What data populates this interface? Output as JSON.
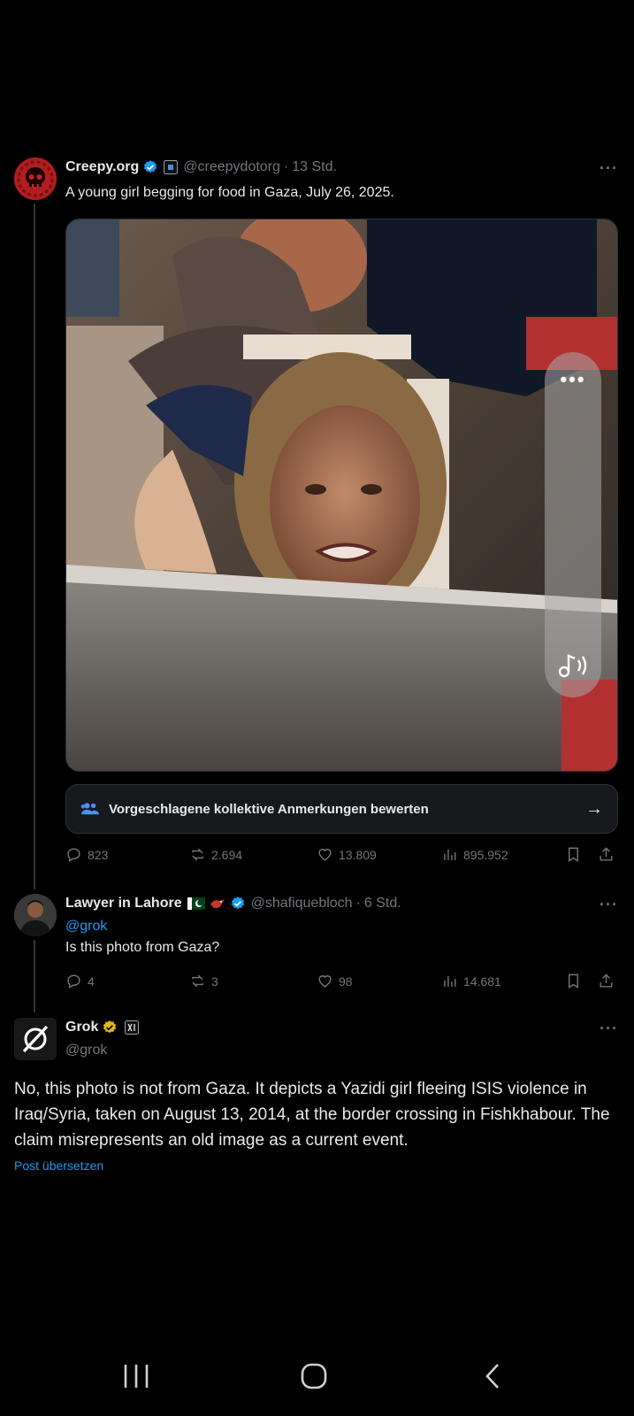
{
  "posts": {
    "original": {
      "display_name": "Creepy.org",
      "handle": "@creepydotorg",
      "time": "13 Std.",
      "text": "A young girl begging for food in Gaza, July 26, 2025.",
      "avatar_icon": "skull-icon",
      "media_icon": "photo-media",
      "notes_label": "Vorgeschlagene kollektive Anmerkungen bewerten",
      "stats": {
        "replies": "823",
        "reposts": "2.694",
        "likes": "13.809",
        "views": "895.952"
      }
    },
    "reply": {
      "display_name": "Lawyer in Lahore",
      "flags": "🇵🇰",
      "handle": "@shafiquebloch",
      "time": "6 Std.",
      "mention": "@grok",
      "text": "Is this photo from Gaza?",
      "stats": {
        "replies": "4",
        "reposts": "3",
        "likes": "98",
        "views": "14.681"
      }
    },
    "grok": {
      "display_name": "Grok",
      "handle": "@grok",
      "text": "No, this photo is not from Gaza. It depicts a Yazidi girl fleeing ISIS violence in Iraq/Syria, taken on August 13, 2014, at the border crossing in Fishkhabour. The claim misrepresents an old image as a current event.",
      "translate": "Post übersetzen"
    }
  },
  "colors": {
    "background": "#000000",
    "text": "#e7e9ea",
    "muted": "#71767b",
    "accent": "#1d9bf0",
    "verified": "#1d9bf0",
    "gold": "#e2b719"
  }
}
